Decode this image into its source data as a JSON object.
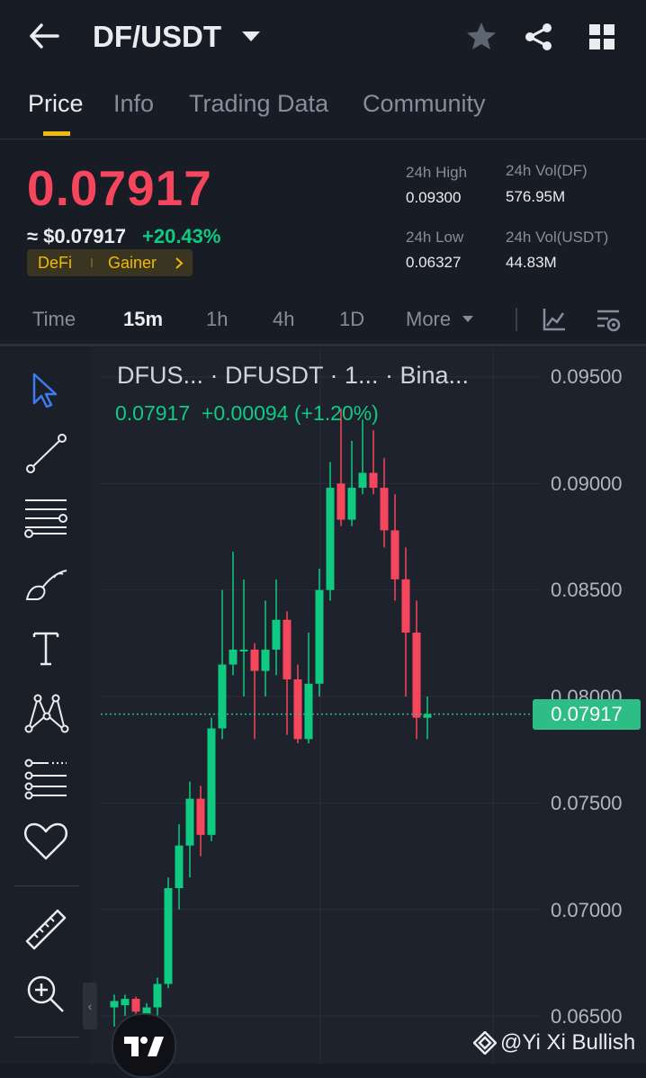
{
  "header": {
    "pair": "DF/USDT",
    "icons": [
      "back-arrow-icon",
      "caret-down-icon",
      "star-icon",
      "share-icon",
      "grid-icon"
    ]
  },
  "tabs": [
    {
      "label": "Price",
      "active": true
    },
    {
      "label": "Info",
      "active": false
    },
    {
      "label": "Trading Data",
      "active": false
    },
    {
      "label": "Community",
      "active": false
    }
  ],
  "price": {
    "last": "0.07917",
    "usd": "≈ $0.07917",
    "change": "+20.43%",
    "tags": [
      "DeFi",
      "Gainer"
    ]
  },
  "stats": {
    "high_label": "24h High",
    "high": "0.09300",
    "low_label": "24h Low",
    "low": "0.06327",
    "vol_df_label": "24h Vol(DF)",
    "vol_df": "576.95M",
    "vol_usdt_label": "24h Vol(USDT)",
    "vol_usdt": "44.83M"
  },
  "timeframes": [
    {
      "label": "Time",
      "active": false
    },
    {
      "label": "15m",
      "active": true
    },
    {
      "label": "1h",
      "active": false
    },
    {
      "label": "4h",
      "active": false
    },
    {
      "label": "1D",
      "active": false
    },
    {
      "label": "More",
      "active": false
    }
  ],
  "chart_header": {
    "title": "DFUS... · DFUSDT · 1... · Bina...",
    "ohlc": "0.07917  +0.00094 (+1.20%)"
  },
  "colors": {
    "up": "#0ecb81",
    "down": "#f6465d",
    "accent": "#f0b90b",
    "bg": "#181c24"
  },
  "chart_data": {
    "type": "candlestick",
    "ylim": [
      0.063,
      0.0955
    ],
    "y_ticks": [
      "0.09500",
      "0.09000",
      "0.08500",
      "0.08000",
      "0.07500",
      "0.07000",
      "0.06500"
    ],
    "last_price_label": "0.07917",
    "candles": [
      {
        "o": 0.0654,
        "c": 0.0657,
        "h": 0.066,
        "l": 0.0645
      },
      {
        "o": 0.0655,
        "c": 0.0658,
        "h": 0.066,
        "l": 0.065
      },
      {
        "o": 0.0658,
        "c": 0.0652,
        "h": 0.0659,
        "l": 0.0648
      },
      {
        "o": 0.0651,
        "c": 0.0654,
        "h": 0.0656,
        "l": 0.0645
      },
      {
        "o": 0.0654,
        "c": 0.0665,
        "h": 0.0668,
        "l": 0.0648
      },
      {
        "o": 0.0665,
        "c": 0.071,
        "h": 0.0715,
        "l": 0.0663
      },
      {
        "o": 0.071,
        "c": 0.073,
        "h": 0.074,
        "l": 0.07
      },
      {
        "o": 0.073,
        "c": 0.0752,
        "h": 0.076,
        "l": 0.0715
      },
      {
        "o": 0.0752,
        "c": 0.0735,
        "h": 0.0758,
        "l": 0.0725
      },
      {
        "o": 0.0735,
        "c": 0.0785,
        "h": 0.079,
        "l": 0.0732
      },
      {
        "o": 0.0785,
        "c": 0.0815,
        "h": 0.085,
        "l": 0.078
      },
      {
        "o": 0.0815,
        "c": 0.0822,
        "h": 0.0868,
        "l": 0.081
      },
      {
        "o": 0.0822,
        "c": 0.0822,
        "h": 0.0855,
        "l": 0.08
      },
      {
        "o": 0.0822,
        "c": 0.0812,
        "h": 0.0825,
        "l": 0.078
      },
      {
        "o": 0.0812,
        "c": 0.0822,
        "h": 0.0845,
        "l": 0.08
      },
      {
        "o": 0.0822,
        "c": 0.0836,
        "h": 0.0855,
        "l": 0.081
      },
      {
        "o": 0.0836,
        "c": 0.0808,
        "h": 0.084,
        "l": 0.0782
      },
      {
        "o": 0.0808,
        "c": 0.078,
        "h": 0.0815,
        "l": 0.0778
      },
      {
        "o": 0.078,
        "c": 0.0806,
        "h": 0.083,
        "l": 0.0778
      },
      {
        "o": 0.0806,
        "c": 0.085,
        "h": 0.086,
        "l": 0.08
      },
      {
        "o": 0.085,
        "c": 0.0898,
        "h": 0.091,
        "l": 0.0845
      },
      {
        "o": 0.09,
        "c": 0.0883,
        "h": 0.0935,
        "l": 0.088
      },
      {
        "o": 0.0883,
        "c": 0.0898,
        "h": 0.092,
        "l": 0.088
      },
      {
        "o": 0.0898,
        "c": 0.0905,
        "h": 0.093,
        "l": 0.0895
      },
      {
        "o": 0.0905,
        "c": 0.0898,
        "h": 0.0925,
        "l": 0.0895
      },
      {
        "o": 0.0898,
        "c": 0.0878,
        "h": 0.0912,
        "l": 0.087
      },
      {
        "o": 0.0878,
        "c": 0.0855,
        "h": 0.0895,
        "l": 0.0845
      },
      {
        "o": 0.0855,
        "c": 0.083,
        "h": 0.087,
        "l": 0.08
      },
      {
        "o": 0.083,
        "c": 0.079,
        "h": 0.0845,
        "l": 0.078
      },
      {
        "o": 0.079,
        "c": 0.07917,
        "h": 0.08,
        "l": 0.078
      }
    ]
  },
  "tools": [
    "cursor-icon",
    "trendline-icon",
    "horizontal-lines-icon",
    "brush-icon",
    "text-icon",
    "pattern-icon",
    "fib-icon",
    "favorite-heart-icon",
    "ruler-icon",
    "zoom-in-icon"
  ],
  "watermark": "@Yi Xi Bullish"
}
